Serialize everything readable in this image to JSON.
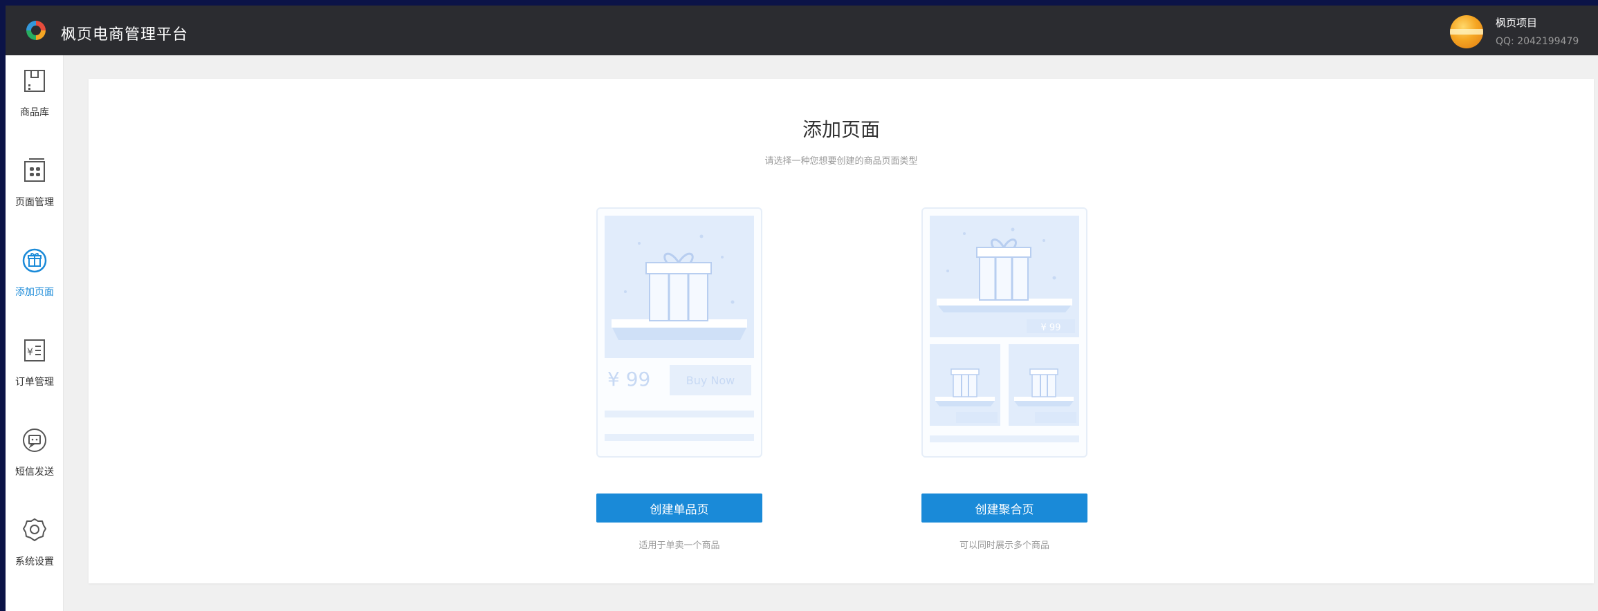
{
  "header": {
    "app_title": "枫页电商管理平台",
    "user_name": "枫页项目",
    "user_qq": "QQ: 2042199479"
  },
  "sidebar": {
    "items": [
      {
        "label": "商品库",
        "icon": "product-library-icon",
        "active": false
      },
      {
        "label": "页面管理",
        "icon": "page-management-icon",
        "active": false
      },
      {
        "label": "添加页面",
        "icon": "add-page-icon",
        "active": true
      },
      {
        "label": "订单管理",
        "icon": "order-management-icon",
        "active": false
      },
      {
        "label": "短信发送",
        "icon": "sms-icon",
        "active": false
      },
      {
        "label": "系统设置",
        "icon": "settings-icon",
        "active": false
      }
    ]
  },
  "main": {
    "title": "添加页面",
    "subtitle": "请选择一种您想要创建的商品页面类型",
    "options": [
      {
        "button": "创建单品页",
        "description": "适用于单卖一个商品",
        "preview_price": "¥ 99",
        "preview_button": "Buy Now"
      },
      {
        "button": "创建聚合页",
        "description": "可以同时展示多个商品",
        "preview_price": "¥ 99"
      }
    ]
  },
  "colors": {
    "accent": "#1a8ad8",
    "topbar": "#2b2c30",
    "background": "#f0f0f0"
  }
}
